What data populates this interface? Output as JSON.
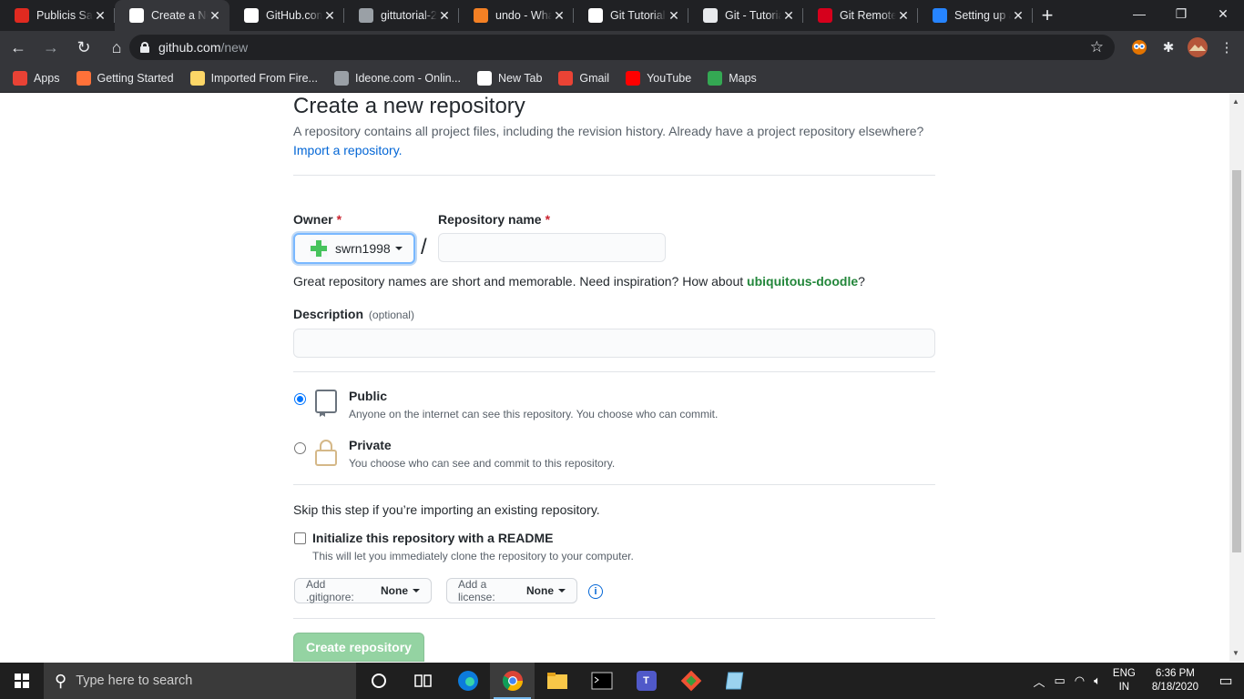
{
  "browser": {
    "tabs": [
      {
        "title": "Publicis Sapient",
        "icon": "publicis-icon",
        "fav_color": "#e02a20"
      },
      {
        "title": "Create a New Repository",
        "icon": "github-icon",
        "fav_color": "#ffffff",
        "active": true
      },
      {
        "title": "GitHub.com Help",
        "icon": "github-icon",
        "fav_color": "#ffffff"
      },
      {
        "title": "gittutorial-2",
        "icon": "globe-icon",
        "fav_color": "#9aa0a6"
      },
      {
        "title": "undo - What's the",
        "icon": "stackoverflow-icon",
        "fav_color": "#f48024"
      },
      {
        "title": "Git Tutorial",
        "icon": "tutorial-icon",
        "fav_color": "#ffffff"
      },
      {
        "title": "Git - Tutorial",
        "icon": "vogella-icon",
        "fav_color": "#e8eaed"
      },
      {
        "title": "Git Remote",
        "icon": "v-icon",
        "fav_color": "#d6001c"
      },
      {
        "title": "Setting up a",
        "icon": "atlassian-icon",
        "fav_color": "#2684ff"
      }
    ],
    "new_tab_symbol": "+",
    "window_controls": {
      "minimize": "—",
      "restore": "❐",
      "close": "✕"
    },
    "url_host": "github.com",
    "url_path": "/new",
    "bookmarks": [
      {
        "label": "Apps",
        "icon": "apps-grid-icon",
        "color": "#e94235"
      },
      {
        "label": "Getting Started",
        "icon": "firefox-icon",
        "color": "#ff7139"
      },
      {
        "label": "Imported From Fire...",
        "icon": "folder-icon",
        "color": "#fcd667"
      },
      {
        "label": "Ideone.com - Onlin...",
        "icon": "ideone-icon",
        "color": "#9aa0a6"
      },
      {
        "label": "New Tab",
        "icon": "globe-icon",
        "color": "#ffffff"
      },
      {
        "label": "Gmail",
        "icon": "gmail-icon",
        "color": "#ea4335"
      },
      {
        "label": "YouTube",
        "icon": "youtube-icon",
        "color": "#ff0000"
      },
      {
        "label": "Maps",
        "icon": "maps-icon",
        "color": "#34a853"
      }
    ]
  },
  "page": {
    "title": "Create a new repository",
    "intro_text": "A repository contains all project files, including the revision history. Already have a project repository elsewhere?",
    "import_link": "Import a repository.",
    "owner_label": "Owner",
    "required_mark": "*",
    "owner_value": "swrn1998",
    "slash": "/",
    "repo_name_label": "Repository name",
    "repo_name_value": "",
    "hint_prefix": "Great repository names are short and memorable. Need inspiration? How about ",
    "hint_suggestion": "ubiquitous-doodle",
    "hint_suffix": "?",
    "description_label": "Description",
    "description_optional": "(optional)",
    "description_value": "",
    "public_title": "Public",
    "public_desc": "Anyone on the internet can see this repository. You choose who can commit.",
    "private_title": "Private",
    "private_desc": "You choose who can see and commit to this repository.",
    "skip_text": "Skip this step if you’re importing an existing repository.",
    "readme_label": "Initialize this repository with a README",
    "readme_desc": "This will let you immediately clone the repository to your computer.",
    "gitignore_label": "Add .gitignore:",
    "gitignore_value": "None",
    "license_label": "Add a license:",
    "license_value": "None",
    "info_symbol": "i",
    "create_button": "Create repository",
    "selected_visibility": "Public",
    "accent_link": "#0366d6",
    "accent_green": "#94d3a2"
  },
  "taskbar": {
    "search_placeholder": "Type here to search",
    "apps": [
      "cortana-icon",
      "task-view-icon",
      "edge-icon",
      "chrome-icon",
      "file-explorer-icon",
      "terminal-icon",
      "teams-icon",
      "git-icon",
      "notepad-icon"
    ],
    "lang_top": "ENG",
    "lang_bottom": "IN",
    "time": "6:36 PM",
    "date": "8/18/2020"
  }
}
